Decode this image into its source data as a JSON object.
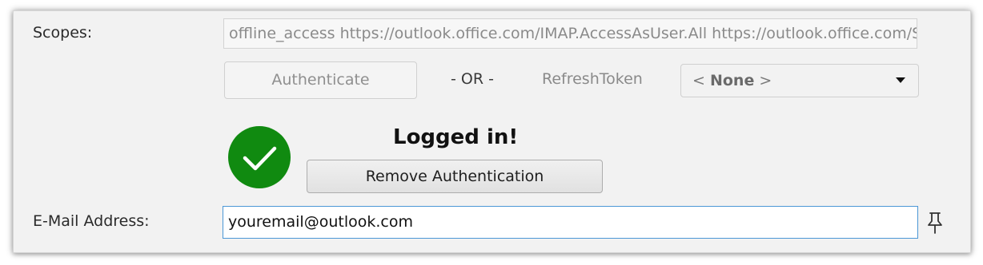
{
  "scopes": {
    "label": "Scopes:",
    "value": "offline_access https://outlook.office.com/IMAP.AccessAsUser.All https://outlook.office.com/SMTP.Send"
  },
  "auth": {
    "authenticate_label": "Authenticate",
    "or_text": "- OR -",
    "refresh_token_label": "RefreshToken",
    "refresh_token_selected": {
      "prefix": "< ",
      "value": "None",
      "suffix": " >"
    }
  },
  "status": {
    "logged_in_text": "Logged in!",
    "remove_auth_label": "Remove Authentication",
    "success_color": "#108a10"
  },
  "email": {
    "label": "E-Mail Address:",
    "value": "youremail@outlook.com"
  },
  "icons": {
    "status": "checkmark-icon",
    "pin": "pin-icon",
    "dropdown": "chevron-down-icon"
  }
}
